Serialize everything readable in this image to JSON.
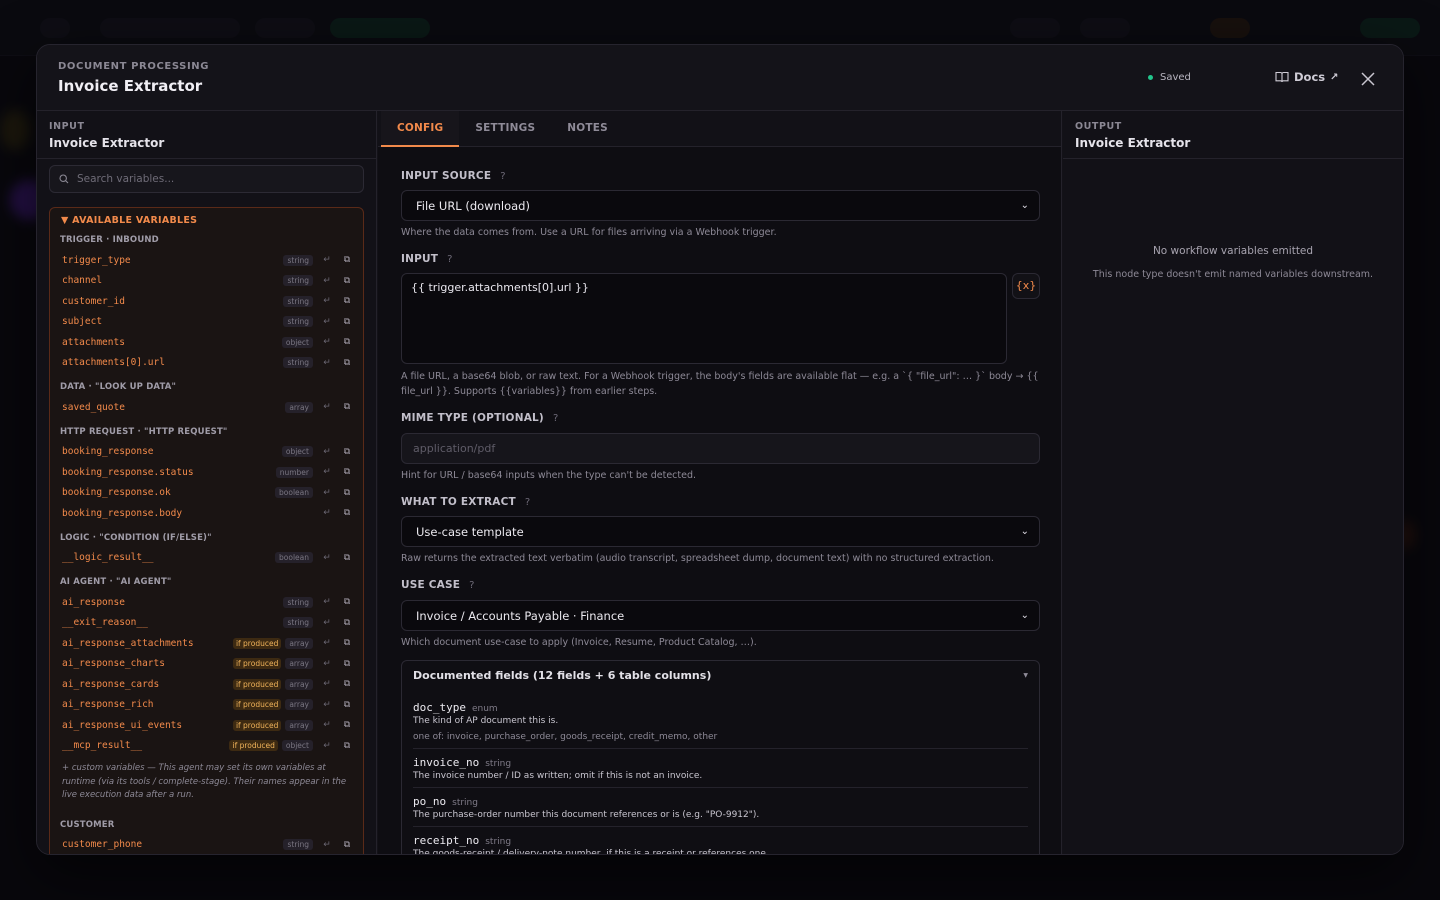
{
  "header": {
    "eyebrow": "DOCUMENT PROCESSING",
    "title": "Invoice Extractor",
    "status": "Saved",
    "docs_label": "Docs",
    "close_icon": "×"
  },
  "colors": {
    "accent": "#f28a4b",
    "saved_dot": "#22c58b"
  },
  "input_pane": {
    "eyebrow": "INPUT",
    "title": "Invoice Extractor",
    "search_placeholder": "Search variables...",
    "vars_header": "▼ AVAILABLE VARIABLES",
    "groups": [
      {
        "label": "TRIGGER · INBOUND",
        "vars": [
          {
            "name": "trigger_type",
            "type": "string",
            "if_produced": ""
          },
          {
            "name": "channel",
            "type": "string",
            "if_produced": ""
          },
          {
            "name": "customer_id",
            "type": "string",
            "if_produced": ""
          },
          {
            "name": "subject",
            "type": "string",
            "if_produced": ""
          },
          {
            "name": "attachments",
            "type": "object",
            "if_produced": ""
          },
          {
            "name": "attachments[0].url",
            "type": "string",
            "if_produced": ""
          }
        ]
      },
      {
        "label": "DATA · \"LOOK UP DATA\"",
        "vars": [
          {
            "name": "saved_quote",
            "type": "array",
            "if_produced": ""
          }
        ]
      },
      {
        "label": "HTTP REQUEST · \"HTTP REQUEST\"",
        "vars": [
          {
            "name": "booking_response",
            "type": "object",
            "if_produced": ""
          },
          {
            "name": "booking_response.status",
            "type": "number",
            "if_produced": ""
          },
          {
            "name": "booking_response.ok",
            "type": "boolean",
            "if_produced": ""
          },
          {
            "name": "booking_response.body",
            "type": "",
            "if_produced": ""
          }
        ]
      },
      {
        "label": "LOGIC · \"CONDITION (IF/ELSE)\"",
        "vars": [
          {
            "name": "__logic_result__",
            "type": "boolean",
            "if_produced": ""
          }
        ]
      },
      {
        "label": "AI AGENT · \"AI AGENT\"",
        "vars": [
          {
            "name": "ai_response",
            "type": "string",
            "if_produced": ""
          },
          {
            "name": "__exit_reason__",
            "type": "string",
            "if_produced": ""
          },
          {
            "name": "ai_response_attachments",
            "type": "array",
            "if_produced": "if produced"
          },
          {
            "name": "ai_response_charts",
            "type": "array",
            "if_produced": "if produced"
          },
          {
            "name": "ai_response_cards",
            "type": "array",
            "if_produced": "if produced"
          },
          {
            "name": "ai_response_rich",
            "type": "array",
            "if_produced": "if produced"
          },
          {
            "name": "ai_response_ui_events",
            "type": "array",
            "if_produced": "if produced"
          },
          {
            "name": "__mcp_result__",
            "type": "object",
            "if_produced": "if produced"
          }
        ]
      },
      {
        "label": "CUSTOMER",
        "vars": [
          {
            "name": "customer_phone",
            "type": "string",
            "if_produced": ""
          }
        ]
      }
    ],
    "custom_note": "+ custom variables — This agent may set its own variables at runtime (via its tools / complete-stage). Their names appear in the live execution data after a run."
  },
  "tabs": [
    "CONFIG",
    "SETTINGS",
    "NOTES"
  ],
  "config": {
    "input_source": {
      "label": "INPUT SOURCE",
      "value": "File URL (download)",
      "help": "Where the data comes from. Use a URL for files arriving via a Webhook trigger."
    },
    "input": {
      "label": "INPUT",
      "value": "{{ trigger.attachments[0].url }}",
      "var_button": "{x}",
      "help": "A file URL, a base64 blob, or raw text. For a Webhook trigger, the body's fields are available flat — e.g. a `{ \"file_url\": … }` body → {{ file_url }}. Supports {{variables}} from earlier steps."
    },
    "mime": {
      "label": "MIME TYPE (OPTIONAL)",
      "placeholder": "application/pdf",
      "help": "Hint for URL / base64 inputs when the type can't be detected."
    },
    "extract": {
      "label": "WHAT TO EXTRACT",
      "value": "Use-case template",
      "help": "Raw returns the extracted text verbatim (audio transcript, spreadsheet dump, document text) with no structured extraction."
    },
    "use_case": {
      "label": "USE CASE",
      "value": "Invoice / Accounts Payable · Finance",
      "help": "Which document use-case to apply (Invoice, Resume, Product Catalog, …)."
    },
    "fields": {
      "title": "Documented fields (12 fields + 6 table columns)",
      "items": [
        {
          "name": "doc_type",
          "type": "enum",
          "desc": "The kind of AP document this is.",
          "opts": "one of: invoice, purchase_order, goods_receipt, credit_memo, other"
        },
        {
          "name": "invoice_no",
          "type": "string",
          "desc": "The invoice number / ID as written; omit if this is not an invoice.",
          "opts": ""
        },
        {
          "name": "po_no",
          "type": "string",
          "desc": "The purchase-order number this document references or is (e.g. \"PO-9912\").",
          "opts": ""
        },
        {
          "name": "receipt_no",
          "type": "string",
          "desc": "The goods-receipt / delivery-note number, if this is a receipt or references one.",
          "opts": ""
        }
      ]
    }
  },
  "output_pane": {
    "eyebrow": "OUTPUT",
    "title": "Invoice Extractor",
    "empty_title": "No workflow variables emitted",
    "empty_sub": "This node type doesn't emit named variables downstream."
  }
}
